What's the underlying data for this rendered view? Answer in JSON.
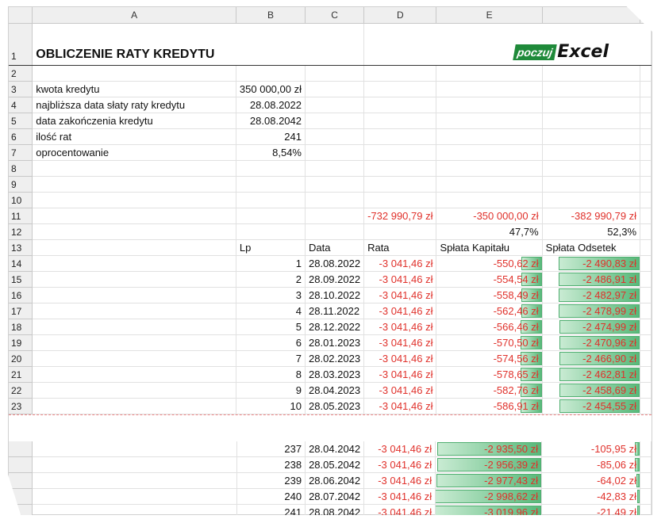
{
  "columns": [
    "A",
    "B",
    "C",
    "D",
    "E"
  ],
  "title": "OBLICZENIE RATY KREDYTU",
  "logo": {
    "poczuj": "poczuj",
    "excel": "Excel"
  },
  "params": [
    {
      "row": "3",
      "label": "kwota kredytu",
      "value": "350 000,00 zł"
    },
    {
      "row": "4",
      "label": "najbliższa data słaty raty kredytu",
      "value": "28.08.2022"
    },
    {
      "row": "5",
      "label": "data zakończenia kredytu",
      "value": "28.08.2042"
    },
    {
      "row": "6",
      "label": "ilość rat",
      "value": "241"
    },
    {
      "row": "7",
      "label": "oprocentowanie",
      "value": "8,54%"
    }
  ],
  "totals": {
    "rata": "-732 990,79 zł",
    "kapital": "-350 000,00 zł",
    "odsetki": "-382 990,79 zł"
  },
  "shares": {
    "kapital": "47,7%",
    "odsetki": "52,3%"
  },
  "headers": {
    "lp": "Lp",
    "data": "Data",
    "rata": "Rata",
    "kapital": "Spłata Kapitału",
    "odsetki": "Spłata Odsetek"
  },
  "rows_top": [
    {
      "row": "14",
      "lp": "1",
      "date": "28.08.2022",
      "rata": "-3 041,46 zł",
      "kap": "-550,62 zł",
      "ods": "-2 490,83 zł",
      "kf": 0.18,
      "of": 0.82
    },
    {
      "row": "15",
      "lp": "2",
      "date": "28.09.2022",
      "rata": "-3 041,46 zł",
      "kap": "-554,54 zł",
      "ods": "-2 486,91 zł",
      "kf": 0.18,
      "of": 0.82
    },
    {
      "row": "16",
      "lp": "3",
      "date": "28.10.2022",
      "rata": "-3 041,46 zł",
      "kap": "-558,49 zł",
      "ods": "-2 482,97 zł",
      "kf": 0.18,
      "of": 0.82
    },
    {
      "row": "17",
      "lp": "4",
      "date": "28.11.2022",
      "rata": "-3 041,46 zł",
      "kap": "-562,46 zł",
      "ods": "-2 478,99 zł",
      "kf": 0.18,
      "of": 0.82
    },
    {
      "row": "18",
      "lp": "5",
      "date": "28.12.2022",
      "rata": "-3 041,46 zł",
      "kap": "-566,46 zł",
      "ods": "-2 474,99 zł",
      "kf": 0.19,
      "of": 0.81
    },
    {
      "row": "19",
      "lp": "6",
      "date": "28.01.2023",
      "rata": "-3 041,46 zł",
      "kap": "-570,50 zł",
      "ods": "-2 470,96 zł",
      "kf": 0.19,
      "of": 0.81
    },
    {
      "row": "20",
      "lp": "7",
      "date": "28.02.2023",
      "rata": "-3 041,46 zł",
      "kap": "-574,56 zł",
      "ods": "-2 466,90 zł",
      "kf": 0.19,
      "of": 0.81
    },
    {
      "row": "21",
      "lp": "8",
      "date": "28.03.2023",
      "rata": "-3 041,46 zł",
      "kap": "-578,65 zł",
      "ods": "-2 462,81 zł",
      "kf": 0.19,
      "of": 0.81
    },
    {
      "row": "22",
      "lp": "9",
      "date": "28.04.2023",
      "rata": "-3 041,46 zł",
      "kap": "-582,76 zł",
      "ods": "-2 458,69 zł",
      "kf": 0.19,
      "of": 0.81
    },
    {
      "row": "23",
      "lp": "10",
      "date": "28.05.2023",
      "rata": "-3 041,46 zł",
      "kap": "-586,91 zł",
      "ods": "-2 454,55 zł",
      "kf": 0.19,
      "of": 0.81
    }
  ],
  "rows_bottom": [
    {
      "lp": "237",
      "date": "28.04.2042",
      "rata": "-3 041,46 zł",
      "kap": "-2 935,50 zł",
      "ods": "-105,95 zł",
      "kf": 0.97,
      "of": 0.03
    },
    {
      "lp": "238",
      "date": "28.05.2042",
      "rata": "-3 041,46 zł",
      "kap": "-2 956,39 zł",
      "ods": "-85,06 zł",
      "kf": 0.97,
      "of": 0.03
    },
    {
      "lp": "239",
      "date": "28.06.2042",
      "rata": "-3 041,46 zł",
      "kap": "-2 977,43 zł",
      "ods": "-64,02 zł",
      "kf": 0.98,
      "of": 0.02
    },
    {
      "lp": "240",
      "date": "28.07.2042",
      "rata": "-3 041,46 zł",
      "kap": "-2 998,62 zł",
      "ods": "-42,83 zł",
      "kf": 0.99,
      "of": 0.01
    },
    {
      "lp": "241",
      "date": "28.08.2042",
      "rata": "-3 041,46 zł",
      "kap": "-3 019,96 zł",
      "ods": "-21,49 zł",
      "kf": 0.99,
      "of": 0.01
    }
  ]
}
